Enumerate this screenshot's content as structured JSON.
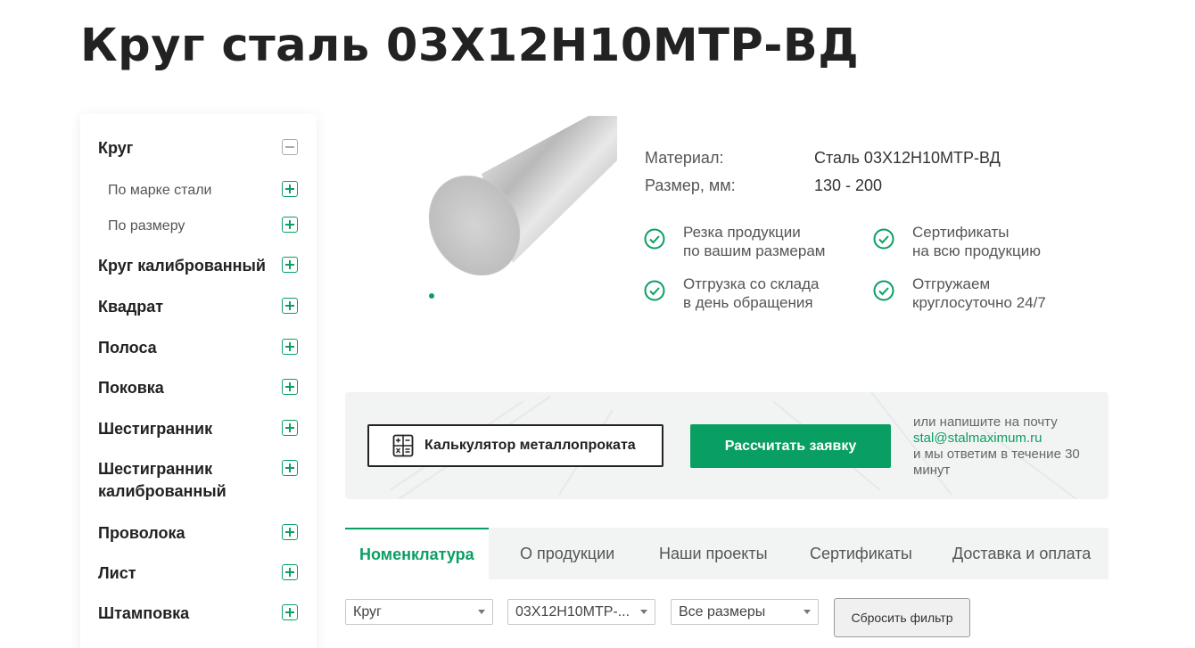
{
  "page": {
    "title": "Круг сталь 03Х12Н10МТР-ВД"
  },
  "sidebar": {
    "items": [
      {
        "label": "Круг",
        "state": "expanded"
      },
      {
        "label": "По марке стали",
        "state": "collapsed",
        "level": 2
      },
      {
        "label": "По размеру",
        "state": "collapsed",
        "level": 2
      },
      {
        "label": "Круг калиброванный",
        "state": "collapsed"
      },
      {
        "label": "Квадрат",
        "state": "collapsed"
      },
      {
        "label": "Полоса",
        "state": "collapsed"
      },
      {
        "label": "Поковка",
        "state": "collapsed"
      },
      {
        "label": "Шестигранник",
        "state": "collapsed"
      },
      {
        "label": "Шестигранник калиброванный",
        "state": "collapsed"
      },
      {
        "label": "Проволока",
        "state": "collapsed"
      },
      {
        "label": "Лист",
        "state": "collapsed"
      },
      {
        "label": "Штамповка",
        "state": "collapsed"
      }
    ]
  },
  "product": {
    "props": [
      {
        "label": "Материал:",
        "value": "Сталь 03Х12Н10МТР-ВД"
      },
      {
        "label": "Размер, мм:",
        "value": "130 - 200"
      }
    ],
    "features": [
      {
        "line1": "Резка продукции",
        "line2": "по вашим размерам"
      },
      {
        "line1": "Сертификаты",
        "line2": "на всю продукцию"
      },
      {
        "line1": "Отгрузка со склада",
        "line2": "в день обращения"
      },
      {
        "line1": "Отгружаем",
        "line2": "круглосуточно 24/7"
      }
    ]
  },
  "calc": {
    "calculator_label": "Калькулятор металлопроката",
    "request_label": "Рассчитать заявку",
    "contact_line1": "или напишите на почту",
    "email": "stal@stalmaximum.ru",
    "contact_line2": "и мы ответим в течение 30 минут"
  },
  "tabs": [
    {
      "label": "Номенклатура",
      "active": true
    },
    {
      "label": "О продукции",
      "active": false
    },
    {
      "label": "Наши проекты",
      "active": false
    },
    {
      "label": "Сертификаты",
      "active": false
    },
    {
      "label": "Доставка и оплата",
      "active": false
    }
  ],
  "filters": {
    "shape": "Круг",
    "grade": "03Х12Н10МТР-...",
    "size": "Все размеры",
    "reset_label": "Сбросить фильтр"
  },
  "colors": {
    "accent": "#0a9f62",
    "panel": "#f2f4f4",
    "text": "#222222"
  }
}
